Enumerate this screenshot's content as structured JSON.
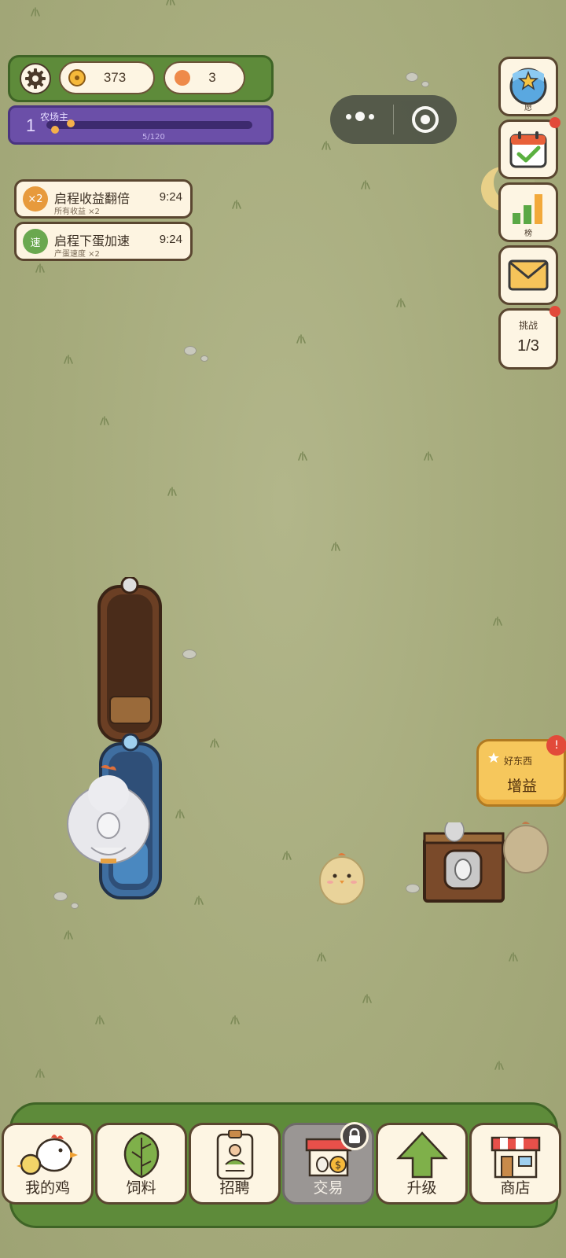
{
  "status": {
    "coins": "373",
    "gems": "3",
    "level": "1",
    "title": "农场主",
    "xp": "5/120",
    "xp_fraction": 0.042
  },
  "buffs": [
    {
      "badge": "×2",
      "title": "启程收益翻倍",
      "sub": "所有收益 ×2",
      "time": "9:24",
      "color": "#e79a3c"
    },
    {
      "badge": "速",
      "title": "启程下蛋加速",
      "sub": "产蛋速度 ×2",
      "time": "9:24",
      "color": "#6aa84f"
    }
  ],
  "side": {
    "wish_label": "愿",
    "rank_label": "榜",
    "challenge_title": "挑战",
    "challenge_value": "1/3"
  },
  "goods": {
    "title": "好东西",
    "main": "增益",
    "alert": "!"
  },
  "nav": {
    "chicken": "我的鸡",
    "feed": "饲料",
    "hire": "招聘",
    "trade": "交易",
    "upgrade": "升级",
    "shop": "商店"
  },
  "icons": {
    "settings": "gear-icon",
    "coin": "coin-icon",
    "gem": "gem-icon",
    "wish": "wish-globe-icon",
    "checkin": "calendar-check-icon",
    "rank": "bar-chart-icon",
    "mail": "envelope-icon",
    "lock": "lock-icon"
  }
}
